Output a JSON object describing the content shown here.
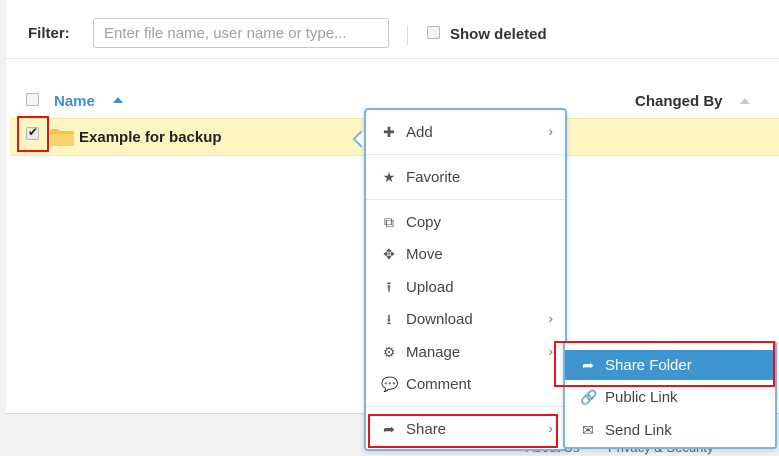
{
  "filter": {
    "label": "Filter:",
    "placeholder": "Enter file name, user name or type...",
    "show_deleted_label": "Show deleted"
  },
  "table": {
    "columns": [
      "Name",
      "Changed By"
    ],
    "rows": [
      {
        "name": "Example for backup",
        "type": "folder",
        "selected": true
      }
    ]
  },
  "context_menu": {
    "items": [
      {
        "label": "Add",
        "icon": "plus-icon",
        "submenu": true
      },
      {
        "label": "Favorite",
        "icon": "star-icon",
        "submenu": false
      },
      {
        "label": "Copy",
        "icon": "copy-icon",
        "submenu": false
      },
      {
        "label": "Move",
        "icon": "move-icon",
        "submenu": false
      },
      {
        "label": "Upload",
        "icon": "upload-icon",
        "submenu": false
      },
      {
        "label": "Download",
        "icon": "download-icon",
        "submenu": true
      },
      {
        "label": "Manage",
        "icon": "gear-icon",
        "submenu": true
      },
      {
        "label": "Comment",
        "icon": "comment-icon",
        "submenu": false
      },
      {
        "label": "Share",
        "icon": "share-icon",
        "submenu": true
      }
    ]
  },
  "share_submenu": {
    "items": [
      {
        "label": "Share Folder",
        "icon": "share-icon",
        "active": true
      },
      {
        "label": "Public Link",
        "icon": "link-icon",
        "active": false
      },
      {
        "label": "Send Link",
        "icon": "envelope-icon",
        "active": false
      }
    ]
  },
  "footer": {
    "about": "About Us",
    "privacy": "Privacy & Security"
  },
  "colors": {
    "accent": "#3f95cf",
    "highlight_row": "#fdf6c3",
    "annotation_red": "#e0161b"
  }
}
